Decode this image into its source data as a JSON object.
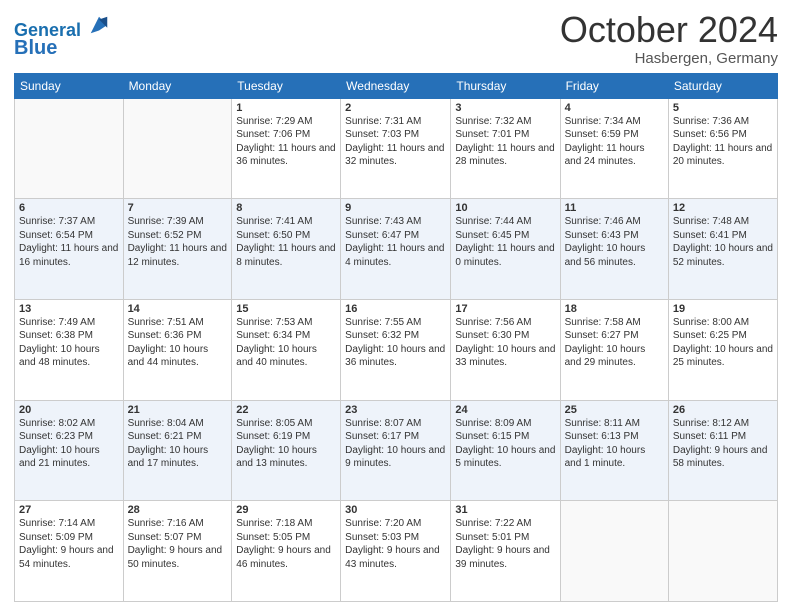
{
  "header": {
    "logo_line1": "General",
    "logo_line2": "Blue",
    "month": "October 2024",
    "location": "Hasbergen, Germany"
  },
  "weekdays": [
    "Sunday",
    "Monday",
    "Tuesday",
    "Wednesday",
    "Thursday",
    "Friday",
    "Saturday"
  ],
  "weeks": [
    [
      {
        "day": "",
        "info": ""
      },
      {
        "day": "",
        "info": ""
      },
      {
        "day": "1",
        "info": "Sunrise: 7:29 AM\nSunset: 7:06 PM\nDaylight: 11 hours and 36 minutes."
      },
      {
        "day": "2",
        "info": "Sunrise: 7:31 AM\nSunset: 7:03 PM\nDaylight: 11 hours and 32 minutes."
      },
      {
        "day": "3",
        "info": "Sunrise: 7:32 AM\nSunset: 7:01 PM\nDaylight: 11 hours and 28 minutes."
      },
      {
        "day": "4",
        "info": "Sunrise: 7:34 AM\nSunset: 6:59 PM\nDaylight: 11 hours and 24 minutes."
      },
      {
        "day": "5",
        "info": "Sunrise: 7:36 AM\nSunset: 6:56 PM\nDaylight: 11 hours and 20 minutes."
      }
    ],
    [
      {
        "day": "6",
        "info": "Sunrise: 7:37 AM\nSunset: 6:54 PM\nDaylight: 11 hours and 16 minutes."
      },
      {
        "day": "7",
        "info": "Sunrise: 7:39 AM\nSunset: 6:52 PM\nDaylight: 11 hours and 12 minutes."
      },
      {
        "day": "8",
        "info": "Sunrise: 7:41 AM\nSunset: 6:50 PM\nDaylight: 11 hours and 8 minutes."
      },
      {
        "day": "9",
        "info": "Sunrise: 7:43 AM\nSunset: 6:47 PM\nDaylight: 11 hours and 4 minutes."
      },
      {
        "day": "10",
        "info": "Sunrise: 7:44 AM\nSunset: 6:45 PM\nDaylight: 11 hours and 0 minutes."
      },
      {
        "day": "11",
        "info": "Sunrise: 7:46 AM\nSunset: 6:43 PM\nDaylight: 10 hours and 56 minutes."
      },
      {
        "day": "12",
        "info": "Sunrise: 7:48 AM\nSunset: 6:41 PM\nDaylight: 10 hours and 52 minutes."
      }
    ],
    [
      {
        "day": "13",
        "info": "Sunrise: 7:49 AM\nSunset: 6:38 PM\nDaylight: 10 hours and 48 minutes."
      },
      {
        "day": "14",
        "info": "Sunrise: 7:51 AM\nSunset: 6:36 PM\nDaylight: 10 hours and 44 minutes."
      },
      {
        "day": "15",
        "info": "Sunrise: 7:53 AM\nSunset: 6:34 PM\nDaylight: 10 hours and 40 minutes."
      },
      {
        "day": "16",
        "info": "Sunrise: 7:55 AM\nSunset: 6:32 PM\nDaylight: 10 hours and 36 minutes."
      },
      {
        "day": "17",
        "info": "Sunrise: 7:56 AM\nSunset: 6:30 PM\nDaylight: 10 hours and 33 minutes."
      },
      {
        "day": "18",
        "info": "Sunrise: 7:58 AM\nSunset: 6:27 PM\nDaylight: 10 hours and 29 minutes."
      },
      {
        "day": "19",
        "info": "Sunrise: 8:00 AM\nSunset: 6:25 PM\nDaylight: 10 hours and 25 minutes."
      }
    ],
    [
      {
        "day": "20",
        "info": "Sunrise: 8:02 AM\nSunset: 6:23 PM\nDaylight: 10 hours and 21 minutes."
      },
      {
        "day": "21",
        "info": "Sunrise: 8:04 AM\nSunset: 6:21 PM\nDaylight: 10 hours and 17 minutes."
      },
      {
        "day": "22",
        "info": "Sunrise: 8:05 AM\nSunset: 6:19 PM\nDaylight: 10 hours and 13 minutes."
      },
      {
        "day": "23",
        "info": "Sunrise: 8:07 AM\nSunset: 6:17 PM\nDaylight: 10 hours and 9 minutes."
      },
      {
        "day": "24",
        "info": "Sunrise: 8:09 AM\nSunset: 6:15 PM\nDaylight: 10 hours and 5 minutes."
      },
      {
        "day": "25",
        "info": "Sunrise: 8:11 AM\nSunset: 6:13 PM\nDaylight: 10 hours and 1 minute."
      },
      {
        "day": "26",
        "info": "Sunrise: 8:12 AM\nSunset: 6:11 PM\nDaylight: 9 hours and 58 minutes."
      }
    ],
    [
      {
        "day": "27",
        "info": "Sunrise: 7:14 AM\nSunset: 5:09 PM\nDaylight: 9 hours and 54 minutes."
      },
      {
        "day": "28",
        "info": "Sunrise: 7:16 AM\nSunset: 5:07 PM\nDaylight: 9 hours and 50 minutes."
      },
      {
        "day": "29",
        "info": "Sunrise: 7:18 AM\nSunset: 5:05 PM\nDaylight: 9 hours and 46 minutes."
      },
      {
        "day": "30",
        "info": "Sunrise: 7:20 AM\nSunset: 5:03 PM\nDaylight: 9 hours and 43 minutes."
      },
      {
        "day": "31",
        "info": "Sunrise: 7:22 AM\nSunset: 5:01 PM\nDaylight: 9 hours and 39 minutes."
      },
      {
        "day": "",
        "info": ""
      },
      {
        "day": "",
        "info": ""
      }
    ]
  ]
}
